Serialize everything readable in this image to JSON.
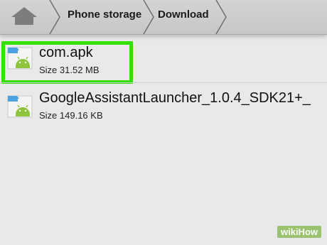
{
  "breadcrumb": {
    "items": [
      "Phone storage",
      "Download"
    ]
  },
  "files": [
    {
      "name": "com.apk",
      "size": "Size 31.52 MB"
    },
    {
      "name": "GoogleAssistantLauncher_1.0.4_SDK21+_",
      "size": "Size 149.16 KB"
    }
  ],
  "watermark": "wikiHow",
  "colors": {
    "highlight": "#33e000",
    "toolbar": "#cccccc",
    "background": "#e9e9e9",
    "android_icon": "#8fc43c",
    "file_tab": "#4aa3e0"
  }
}
